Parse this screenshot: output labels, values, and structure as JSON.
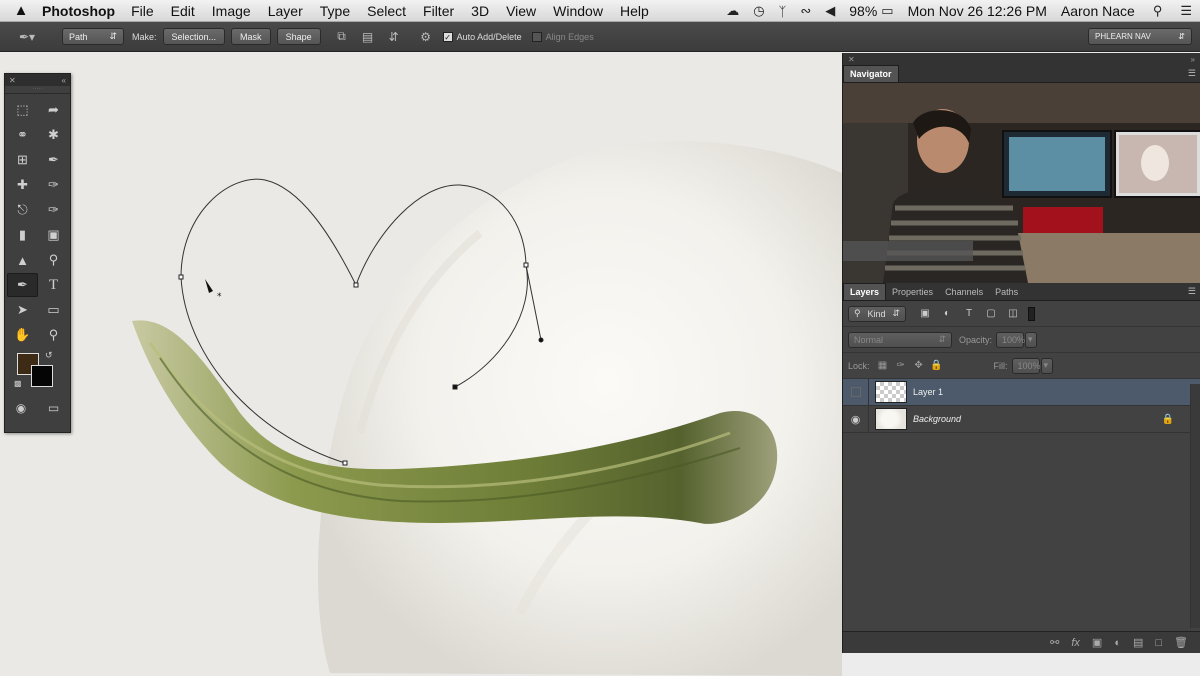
{
  "menubar": {
    "apple": "",
    "app_name": "Photoshop",
    "menus": [
      "File",
      "Edit",
      "Image",
      "Layer",
      "Type",
      "Select",
      "Filter",
      "3D",
      "View",
      "Window",
      "Help"
    ],
    "battery": "98%",
    "datetime": "Mon Nov 26  12:26 PM",
    "user": "Aaron Nace",
    "icons": [
      "creative-cloud-icon",
      "time-machine-icon",
      "bluetooth-icon",
      "wifi-icon",
      "volume-icon",
      "battery-icon",
      "search-icon",
      "list-icon"
    ]
  },
  "options": {
    "mode": "Path",
    "make_label": "Make:",
    "selection_btn": "Selection...",
    "mask_btn": "Mask",
    "shape_btn": "Shape",
    "auto_add_delete": "Auto Add/Delete",
    "align_edges": "Align Edges",
    "workspace": "PHLEARN NAV"
  },
  "tools": {
    "text_tool_glyph": "T"
  },
  "navigator": {
    "tab": "Navigator"
  },
  "layers_panel": {
    "tabs": [
      "Layers",
      "Properties",
      "Channels",
      "Paths"
    ],
    "filter_kind": "Kind",
    "blend_mode": "Normal",
    "opacity_label": "Opacity:",
    "opacity_value": "100%",
    "lock_label": "Lock:",
    "fill_label": "Fill:",
    "fill_value": "100%",
    "layers": [
      {
        "name": "Layer 1"
      },
      {
        "name": "Background"
      }
    ]
  },
  "colors": {
    "foreground": "#3d2b15",
    "background": "#050505",
    "selected_layer": "#4c5a6c",
    "panel": "#424242"
  }
}
